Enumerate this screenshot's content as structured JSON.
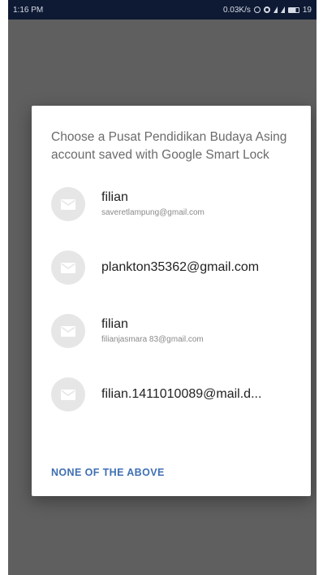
{
  "status_bar": {
    "time": "1:16 PM",
    "network_speed": "0.03K/s",
    "battery": "19"
  },
  "dialog": {
    "title": "Choose a Pusat Pendidikan Budaya Asing account saved with Google Smart Lock",
    "accounts": [
      {
        "name": "filian",
        "email": "saveretlampung@gmail.com"
      },
      {
        "name": "plankton35362@gmail.com",
        "email": ""
      },
      {
        "name": "filian",
        "email": "filianjasmara 83@gmail.com"
      },
      {
        "name": "filian.1411010089@mail.d...",
        "email": ""
      }
    ],
    "none_label": "NONE OF THE ABOVE"
  },
  "colors": {
    "scrim": "#5f5f5f",
    "status_bar": "#0e1a33",
    "accent": "#3f6fb5",
    "avatar_bg": "#e6e6e6"
  },
  "icons": {
    "avatar": "envelope-icon"
  }
}
